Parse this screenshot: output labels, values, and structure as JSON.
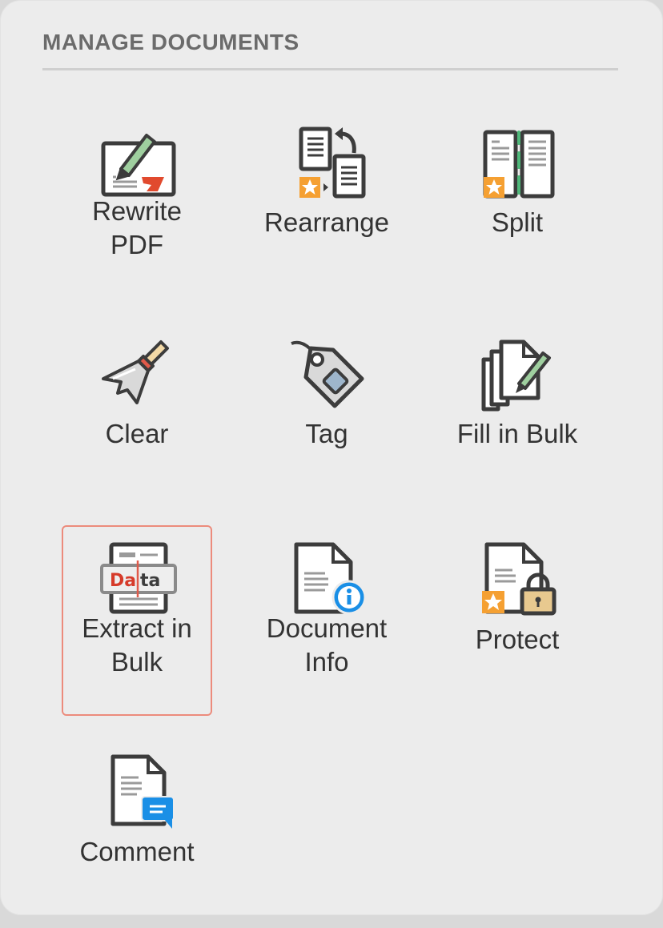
{
  "panel": {
    "title": "MANAGE DOCUMENTS",
    "selected_tool": "Extract in Bulk",
    "tools": [
      {
        "id": "rewrite",
        "line1": "Rewrite",
        "line2": "PDF",
        "icon": "rewrite-pdf-icon"
      },
      {
        "id": "rearrange",
        "line1": "Rearrange",
        "icon": "rearrange-icon"
      },
      {
        "id": "split",
        "line1": "Split",
        "icon": "split-icon"
      },
      {
        "id": "clear",
        "line1": "Clear",
        "icon": "broom-icon"
      },
      {
        "id": "tag",
        "line1": "Tag",
        "icon": "tag-icon"
      },
      {
        "id": "fill",
        "line1": "Fill in Bulk",
        "icon": "fill-in-bulk-icon"
      },
      {
        "id": "extract",
        "line1": "Extract in",
        "line2": "Bulk",
        "icon": "extract-data-icon",
        "icon_text": "Data"
      },
      {
        "id": "info",
        "line1": "Document",
        "line2": "Info",
        "icon": "document-info-icon"
      },
      {
        "id": "protect",
        "line1": "Protect",
        "icon": "lock-icon"
      },
      {
        "id": "comment",
        "line1": "Comment",
        "icon": "comment-icon"
      }
    ]
  },
  "colors": {
    "panel_background": "#ececec",
    "title": "#6b6b6b",
    "divider": "#cfcfcf",
    "icon_stroke": "#3c3c3c",
    "star_badge": "#f5a032",
    "info_blue": "#1a8fe6",
    "data_red": "#d63b2a",
    "pen_green": "#9fcf9f",
    "split_green": "#4fb87a",
    "selected_border": "#ec8b7c"
  }
}
